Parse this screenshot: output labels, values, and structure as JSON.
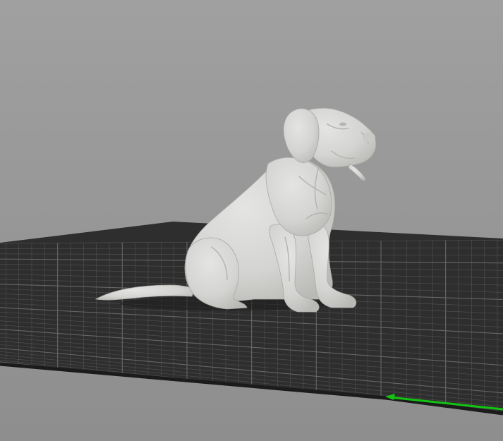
{
  "viewport": {
    "background_top": "#a0a0a0",
    "background_bottom": "#8e8e8e"
  },
  "build_plate": {
    "surface_color": "#2e2e2e",
    "grid_line_color": "#6a6a6a",
    "edge_color": "#1b1b1b",
    "x_axis_color": "#12c412"
  },
  "model": {
    "name": "dog-figurine",
    "color": "#d6d6d4",
    "shadow_color": "#a9a9a6"
  }
}
